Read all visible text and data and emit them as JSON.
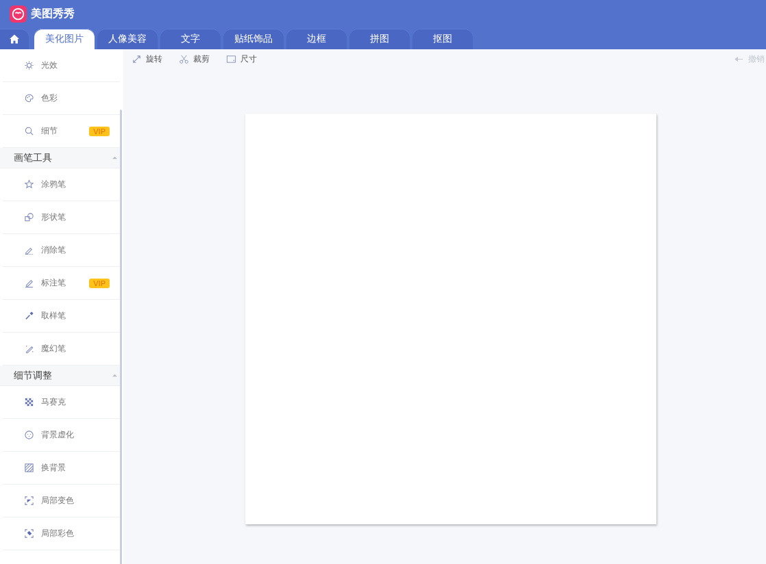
{
  "app": {
    "title": "美图秀秀"
  },
  "tabs": [
    {
      "label": "美化图片",
      "selected": true
    },
    {
      "label": "人像美容",
      "selected": false
    },
    {
      "label": "文字",
      "selected": false
    },
    {
      "label": "贴纸饰品",
      "selected": false
    },
    {
      "label": "边框",
      "selected": false
    },
    {
      "label": "拼图",
      "selected": false
    },
    {
      "label": "抠图",
      "selected": false
    }
  ],
  "sidebar": {
    "sections": [
      {
        "items": [
          {
            "label": "光效"
          },
          {
            "label": "色彩"
          },
          {
            "label": "细节",
            "badge": "VIP"
          }
        ]
      },
      {
        "title": "画笔工具",
        "expanded": true,
        "items": [
          {
            "label": "涂鸦笔"
          },
          {
            "label": "形状笔"
          },
          {
            "label": "消除笔"
          },
          {
            "label": "标注笔",
            "badge": "VIP"
          },
          {
            "label": "取样笔"
          },
          {
            "label": "魔幻笔"
          }
        ]
      },
      {
        "title": "细节调整",
        "expanded": true,
        "items": [
          {
            "label": "马赛克"
          },
          {
            "label": "背景虚化"
          },
          {
            "label": "换背景"
          },
          {
            "label": "局部变色"
          },
          {
            "label": "局部彩色"
          }
        ]
      }
    ]
  },
  "toolbar": {
    "tools": [
      {
        "label": "旋转"
      },
      {
        "label": "裁剪"
      },
      {
        "label": "尺寸"
      }
    ],
    "undo": {
      "label": "撤销",
      "disabled": true
    }
  }
}
